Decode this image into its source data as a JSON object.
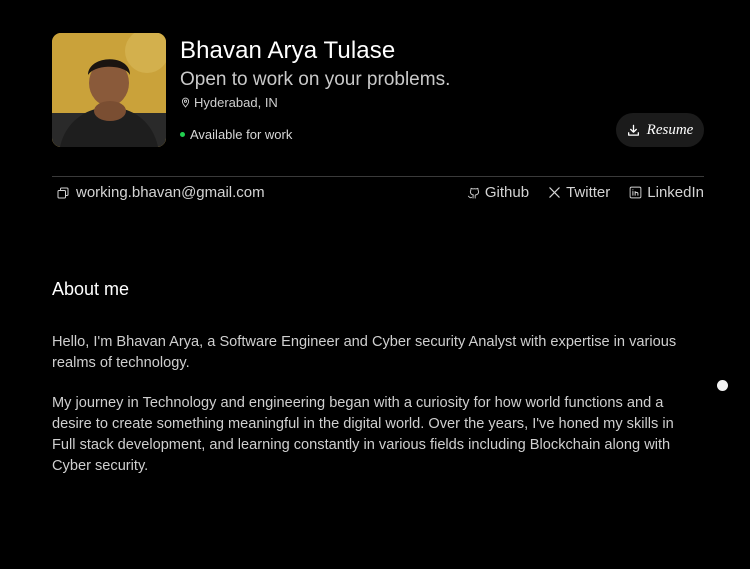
{
  "profile": {
    "name": "Bhavan Arya Tulase",
    "tagline": "Open to work on your problems.",
    "location": "Hyderabad, IN",
    "status": "Available for work",
    "status_color": "#21d04f"
  },
  "resume": {
    "label": "Resume"
  },
  "contact": {
    "email": "working.bhavan@gmail.com",
    "links": [
      {
        "label": "Github",
        "icon": "github-icon"
      },
      {
        "label": "Twitter",
        "icon": "x-icon"
      },
      {
        "label": "LinkedIn",
        "icon": "linkedin-icon"
      }
    ]
  },
  "about": {
    "title": "About me",
    "paragraphs": [
      "Hello, I'm Bhavan Arya, a Software Engineer and Cyber security Analyst with expertise in various realms of technology.",
      "My journey in Technology and engineering began with a curiosity for how world functions and a desire to create something meaningful in the digital world. Over the years, I've honed my skills in Full stack development, and learning constantly in various fields including Blockchain along with Cyber security."
    ]
  },
  "colors": {
    "background": "#000000",
    "avatar_background": "#c9a133"
  }
}
